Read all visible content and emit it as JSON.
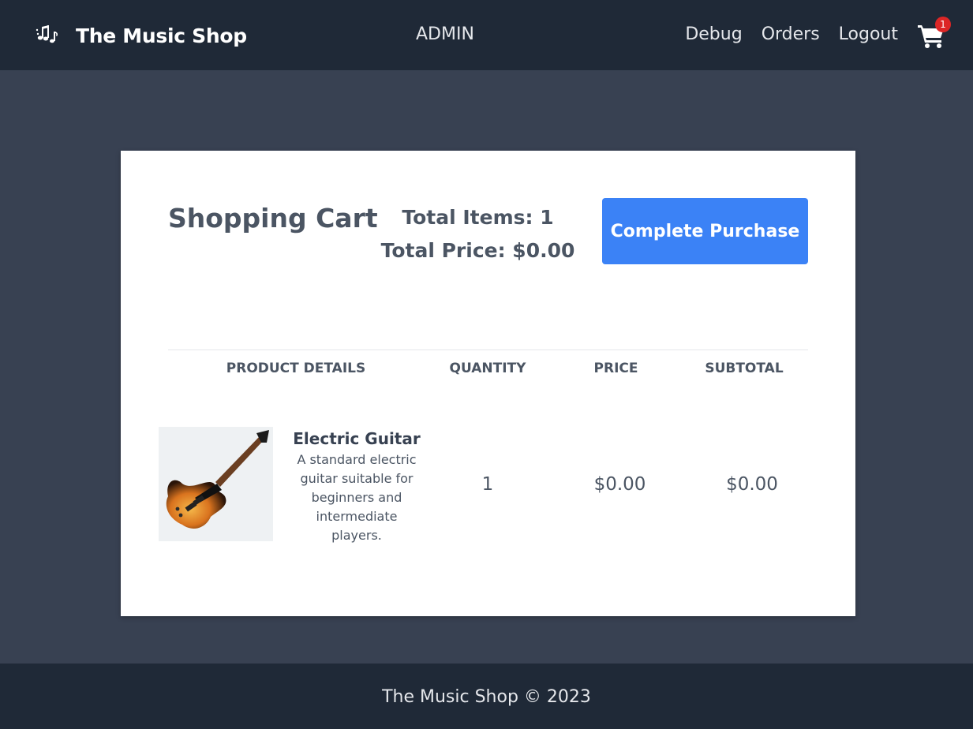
{
  "navbar": {
    "brand_icon": "music-notes-icon",
    "brand_title": "The Music Shop",
    "admin_label": "ADMIN",
    "links": [
      "Debug",
      "Orders",
      "Logout"
    ],
    "cart_icon": "shopping-cart-icon",
    "cart_count": "1"
  },
  "cart": {
    "title": "Shopping Cart",
    "total_items": "Total Items: 1",
    "total_price": "Total Price: $0.00",
    "purchase_button": "Complete Purchase",
    "columns": [
      "PRODUCT DETAILS",
      "QUANTITY",
      "PRICE",
      "SUBTOTAL"
    ],
    "items": [
      {
        "name": "Electric Guitar",
        "description": "A standard electric guitar suitable for beginners and intermediate players.",
        "quantity": "1",
        "price": "$0.00",
        "subtotal": "$0.00"
      }
    ]
  },
  "footer": {
    "text": "The Music Shop © 2023"
  },
  "colors": {
    "navbar": "#1f2937",
    "page_bg": "#384152",
    "accent": "#3b82f6",
    "badge": "#dc2626"
  }
}
